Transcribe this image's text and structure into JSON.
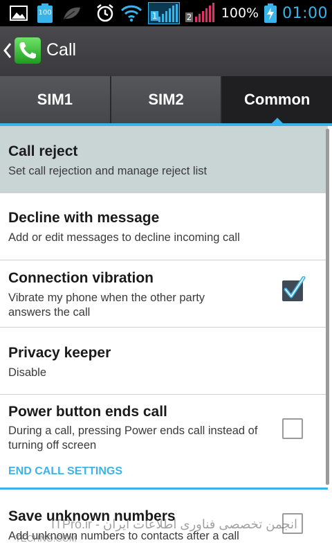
{
  "status_bar": {
    "battery_percent": "100%",
    "time": "01:00",
    "sim1_label": "1",
    "sim2_label": "2",
    "notif_battery_label": "100"
  },
  "action_bar": {
    "title": "Call"
  },
  "tabs": [
    {
      "label": "SIM1",
      "active": false
    },
    {
      "label": "SIM2",
      "active": false
    },
    {
      "label": "Common",
      "active": true
    }
  ],
  "items": [
    {
      "title": "Call reject",
      "subtitle": "Set call rejection and manage reject list",
      "highlighted": true
    },
    {
      "title": "Decline with message",
      "subtitle": "Add or edit messages to decline incoming call"
    },
    {
      "title": "Connection vibration",
      "subtitle": "Vibrate my phone when the other party answers the call",
      "checked": true
    },
    {
      "title": "Privacy keeper",
      "subtitle": "Disable"
    },
    {
      "title": "Power button ends call",
      "subtitle": "During a call, pressing Power ends call instead of turning off screen",
      "checked": false
    }
  ],
  "section_header": "END CALL SETTINGS",
  "items_after": [
    {
      "title": "Save unknown numbers",
      "subtitle": "Add unknown numbers to contacts after a call",
      "checked": false
    }
  ],
  "watermark": "ITPro.ir - انجمن تخصصی فناوری اطلاعات ایران",
  "watermark2": "TECHNO.COM",
  "colors": {
    "accent": "#3ab4e8",
    "highlight_row": "#c9d4d5",
    "actionbar": "#414144"
  }
}
